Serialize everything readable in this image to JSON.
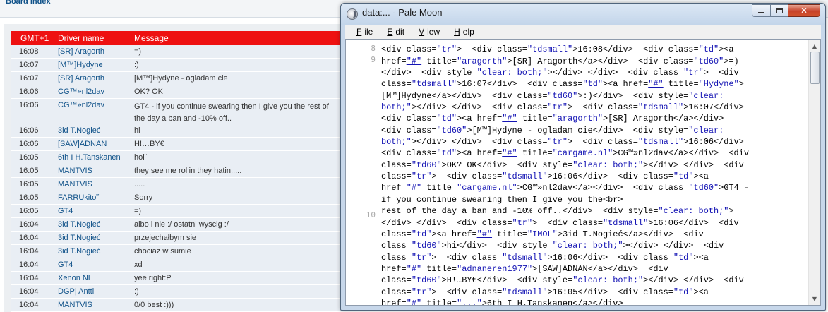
{
  "forum": {
    "breadcrumb": "Board index",
    "header": {
      "time": "GMT+1",
      "driver": "Driver name",
      "message": "Message"
    },
    "rows": [
      {
        "time": "16:08",
        "driver": "[SR] Aragorth",
        "message": "=)"
      },
      {
        "time": "16:07",
        "driver": "[M™]Hydyne",
        "message": ":)"
      },
      {
        "time": "16:07",
        "driver": "[SR] Aragorth",
        "message": "[M™]Hydyne - ogladam cie"
      },
      {
        "time": "16:06",
        "driver": "CG™»nl2dav",
        "message": "OK? OK"
      },
      {
        "time": "16:06",
        "driver": "CG™»nl2dav",
        "message": "GT4 - if you continue swearing then I give you the rest of the day a ban and -10% off..",
        "tall": true
      },
      {
        "time": "16:06",
        "driver": "3id T.Nogieć",
        "message": "hi"
      },
      {
        "time": "16:06",
        "driver": "[SAW]ADNAN",
        "message": "H!…BY€"
      },
      {
        "time": "16:05",
        "driver": "6th I H.Tanskanen",
        "message": "hoi¨"
      },
      {
        "time": "16:05",
        "driver": "MANTVIS",
        "message": "they see me rollin they hatin....."
      },
      {
        "time": "16:05",
        "driver": "MANTVIS",
        "message": "....."
      },
      {
        "time": "16:05",
        "driver": "FARRUkito˜",
        "message": "Sorry"
      },
      {
        "time": "16:05",
        "driver": "GT4",
        "message": "=)"
      },
      {
        "time": "16:04",
        "driver": "3id T.Nogieć",
        "message": "albo i nie :/ ostatni wyscig :/"
      },
      {
        "time": "16:04",
        "driver": "3id T.Nogieć",
        "message": "przejechałbym sie"
      },
      {
        "time": "16:04",
        "driver": "3id T.Nogieć",
        "message": "chociaż w sumie"
      },
      {
        "time": "16:04",
        "driver": "GT4",
        "message": "xd"
      },
      {
        "time": "16:04",
        "driver": "Xenon NL",
        "message": "yee right:P"
      },
      {
        "time": "16:04",
        "driver": "DGP| Antti",
        "message": ":)"
      },
      {
        "time": "16:04",
        "driver": "MANTVIS",
        "message": "0/0 best :)))"
      },
      {
        "time": "16:04",
        "driver": "Xenon NL",
        "message": "good race"
      }
    ]
  },
  "browser": {
    "title": "data:... - Pale Moon",
    "icon": "pale-moon-icon",
    "menu": [
      {
        "label": "File",
        "key": "F",
        "rest": "ile"
      },
      {
        "label": "Edit",
        "key": "E",
        "rest": "dit"
      },
      {
        "label": "View",
        "key": "V",
        "rest": "iew"
      },
      {
        "label": "Help",
        "key": "H",
        "rest": "elp"
      }
    ],
    "close_glyph": "✕",
    "line_numbers": [
      "8",
      "9",
      "10"
    ],
    "source_lines": [
      [
        {
          "t": "  "
        }
      ],
      [
        {
          "t": "<div class="
        },
        {
          "t": "\"tr\"",
          "c": "s"
        },
        {
          "t": ">  <div class="
        },
        {
          "t": "\"tdsmall\"",
          "c": "s"
        },
        {
          "t": ">16:08</div>  <div class="
        },
        {
          "t": "\"td\"",
          "c": "s"
        },
        {
          "t": "><a"
        }
      ],
      [
        {
          "t": "href="
        },
        {
          "t": "\"#\"",
          "c": "l"
        },
        {
          "t": " title="
        },
        {
          "t": "\"aragorth\"",
          "c": "s"
        },
        {
          "t": ">[SR] Aragorth</a></div>  <div class="
        },
        {
          "t": "\"td60\"",
          "c": "s"
        },
        {
          "t": ">=)"
        }
      ],
      [
        {
          "t": "</div>  <div style="
        },
        {
          "t": "\"clear: both;\"",
          "c": "s"
        },
        {
          "t": "></div> </div>  <div class="
        },
        {
          "t": "\"tr\"",
          "c": "s"
        },
        {
          "t": ">  <div"
        }
      ],
      [
        {
          "t": "class="
        },
        {
          "t": "\"tdsmall\"",
          "c": "s"
        },
        {
          "t": ">16:07</div>  <div class="
        },
        {
          "t": "\"td\"",
          "c": "s"
        },
        {
          "t": "><a href="
        },
        {
          "t": "\"#\"",
          "c": "l"
        },
        {
          "t": " title="
        },
        {
          "t": "\"Hydyne\"",
          "c": "s"
        },
        {
          "t": ">"
        }
      ],
      [
        {
          "t": "[M™]Hydyne</a></div>  <div class="
        },
        {
          "t": "\"td60\"",
          "c": "s"
        },
        {
          "t": ">:)</div>  <div style="
        },
        {
          "t": "\"clear:",
          "c": "s"
        }
      ],
      [
        {
          "t": "both;\"",
          "c": "s"
        },
        {
          "t": "></div> </div>  <div class="
        },
        {
          "t": "\"tr\"",
          "c": "s"
        },
        {
          "t": ">  <div class="
        },
        {
          "t": "\"tdsmall\"",
          "c": "s"
        },
        {
          "t": ">16:07</div>"
        }
      ],
      [
        {
          "t": "<div class="
        },
        {
          "t": "\"td\"",
          "c": "s"
        },
        {
          "t": "><a href="
        },
        {
          "t": "\"#\"",
          "c": "l"
        },
        {
          "t": " title="
        },
        {
          "t": "\"aragorth\"",
          "c": "s"
        },
        {
          "t": ">[SR] Aragorth</a></div>"
        }
      ],
      [
        {
          "t": "<div class="
        },
        {
          "t": "\"td60\"",
          "c": "s"
        },
        {
          "t": ">[M™]Hydyne - ogladam cie</div>  <div style="
        },
        {
          "t": "\"clear:",
          "c": "s"
        }
      ],
      [
        {
          "t": "both;\"",
          "c": "s"
        },
        {
          "t": "></div> </div>  <div class="
        },
        {
          "t": "\"tr\"",
          "c": "s"
        },
        {
          "t": ">  <div class="
        },
        {
          "t": "\"tdsmall\"",
          "c": "s"
        },
        {
          "t": ">16:06</div>"
        }
      ],
      [
        {
          "t": "<div class="
        },
        {
          "t": "\"td\"",
          "c": "s"
        },
        {
          "t": "><a href="
        },
        {
          "t": "\"#\"",
          "c": "l"
        },
        {
          "t": " title="
        },
        {
          "t": "\"cargame.nl\"",
          "c": "s"
        },
        {
          "t": ">CG™»nl2dav</a></div>  <div"
        }
      ],
      [
        {
          "t": "class="
        },
        {
          "t": "\"td60\"",
          "c": "s"
        },
        {
          "t": ">OK? OK</div>  <div style="
        },
        {
          "t": "\"clear: both;\"",
          "c": "s"
        },
        {
          "t": "></div> </div>  <div"
        }
      ],
      [
        {
          "t": "class="
        },
        {
          "t": "\"tr\"",
          "c": "s"
        },
        {
          "t": ">  <div class="
        },
        {
          "t": "\"tdsmall\"",
          "c": "s"
        },
        {
          "t": ">16:06</div>  <div class="
        },
        {
          "t": "\"td\"",
          "c": "s"
        },
        {
          "t": "><a"
        }
      ],
      [
        {
          "t": "href="
        },
        {
          "t": "\"#\"",
          "c": "l"
        },
        {
          "t": " title="
        },
        {
          "t": "\"cargame.nl\"",
          "c": "s"
        },
        {
          "t": ">CG™»nl2dav</a></div>  <div class="
        },
        {
          "t": "\"td60\"",
          "c": "s"
        },
        {
          "t": ">GT4 -"
        }
      ],
      [
        {
          "t": "if you continue swearing then I give you the<br>"
        }
      ],
      [
        {
          "t": "rest of the day a ban and -10% off..</div>  <div style="
        },
        {
          "t": "\"clear: both;\"",
          "c": "s"
        },
        {
          "t": ">"
        }
      ],
      [
        {
          "t": "</div> </div>  <div class="
        },
        {
          "t": "\"tr\"",
          "c": "s"
        },
        {
          "t": ">  <div class="
        },
        {
          "t": "\"tdsmall\"",
          "c": "s"
        },
        {
          "t": ">16:06</div>  <div"
        }
      ],
      [
        {
          "t": "class="
        },
        {
          "t": "\"td\"",
          "c": "s"
        },
        {
          "t": "><a href="
        },
        {
          "t": "\"#\"",
          "c": "l"
        },
        {
          "t": " title="
        },
        {
          "t": "\"IMOL\"",
          "c": "s"
        },
        {
          "t": ">3id T.Nogieć</a></div>  <div"
        }
      ],
      [
        {
          "t": "class="
        },
        {
          "t": "\"td60\"",
          "c": "s"
        },
        {
          "t": ">hi</div>  <div style="
        },
        {
          "t": "\"clear: both;\"",
          "c": "s"
        },
        {
          "t": "></div> </div>  <div"
        }
      ],
      [
        {
          "t": "class="
        },
        {
          "t": "\"tr\"",
          "c": "s"
        },
        {
          "t": ">  <div class="
        },
        {
          "t": "\"tdsmall\"",
          "c": "s"
        },
        {
          "t": ">16:06</div>  <div class="
        },
        {
          "t": "\"td\"",
          "c": "s"
        },
        {
          "t": "><a"
        }
      ],
      [
        {
          "t": "href="
        },
        {
          "t": "\"#\"",
          "c": "l"
        },
        {
          "t": " title="
        },
        {
          "t": "\"adnaneren1977\"",
          "c": "s"
        },
        {
          "t": ">[SAW]ADNAN</a></div>  <div"
        }
      ],
      [
        {
          "t": "class="
        },
        {
          "t": "\"td60\"",
          "c": "s"
        },
        {
          "t": ">H!…BY€</div>  <div style="
        },
        {
          "t": "\"clear: both;\"",
          "c": "s"
        },
        {
          "t": "></div> </div>  <div"
        }
      ],
      [
        {
          "t": "class="
        },
        {
          "t": "\"tr\"",
          "c": "s"
        },
        {
          "t": ">  <div class="
        },
        {
          "t": "\"tdsmall\"",
          "c": "s"
        },
        {
          "t": ">16:05</div>  <div class="
        },
        {
          "t": "\"td\"",
          "c": "s"
        },
        {
          "t": "><a"
        }
      ],
      [
        {
          "t": "href="
        },
        {
          "t": "\"#\"",
          "c": "l"
        },
        {
          "t": " title="
        },
        {
          "t": "\"...\"",
          "c": "s"
        },
        {
          "t": ">6th I H.Tanskanen</a></div>"
        }
      ]
    ]
  }
}
